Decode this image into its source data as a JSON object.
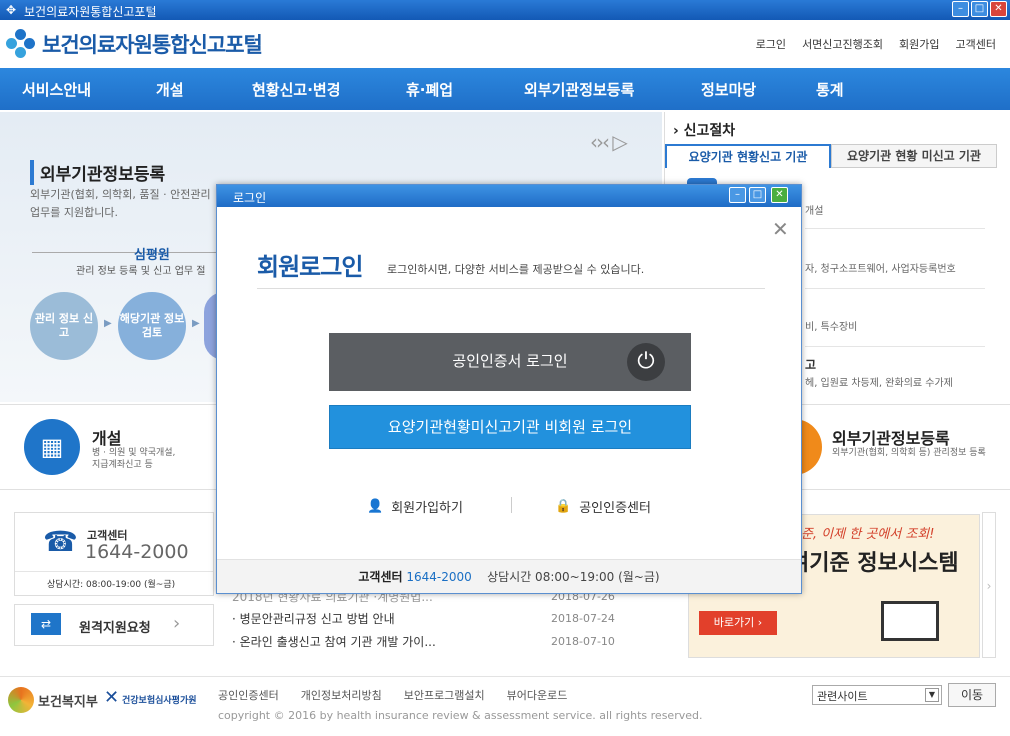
{
  "window": {
    "title": "보건의료자원통합신고포털"
  },
  "header": {
    "logo_text": "보건의료자원통합신고포털",
    "util_links": [
      "로그인",
      "서면신고진행조회",
      "회원가입",
      "고객센터"
    ]
  },
  "gnb": {
    "items": [
      "서비스안내",
      "개설",
      "현황신고·변경",
      "휴·폐업",
      "외부기관정보등록",
      "정보마당",
      "통계"
    ]
  },
  "visual": {
    "title": "외부기관정보등록",
    "desc": "외부기관(협회, 의학회, 품질 · 안전관리",
    "desc2": "업무를 지원합니다.",
    "sim_title": "심평원",
    "sim_desc": "관리 정보 등록 및 신고 업무 절",
    "steps": [
      "관리 정보 신고",
      "해당기관 정보검토"
    ]
  },
  "right_panel": {
    "heading": "신고절차",
    "tabs": [
      "요양기관 현황신고 기관",
      "요양기관 현황 미신고 기관"
    ],
    "items": [
      "개설",
      "자, 청구소프트웨어, 사업자등록번호",
      "비, 특수장비",
      "고",
      "헤, 입원료 차등제, 완화의료 수가제"
    ]
  },
  "quick": {
    "open_title": "개설",
    "open_desc1": "병 · 의원 및 약국개설,",
    "open_desc2": "지급계좌신고 등",
    "ext_title": "외부기관정보등록",
    "ext_desc": "외부기관(협회, 의학회 등) 관리정보 등록"
  },
  "callcenter": {
    "label": "고객센터",
    "number": "1644-2000",
    "hours": "상담시간: 08:00-19:00 (월~금)"
  },
  "remote": {
    "label": "원격지원요청"
  },
  "news": [
    {
      "title": "2018년 현황자료 의료기관 ·계명원법...",
      "date": "2018-07-26"
    },
    {
      "title": "병문안관리규정 신고 방법 안내",
      "date": "2018-07-24"
    },
    {
      "title": "온라인 출생신고 참여 기관 개발 가이...",
      "date": "2018-07-10"
    }
  ],
  "banner": {
    "text1": "기준, 이제 한 곳에서 조회!",
    "text2": "여기준 정보시스템",
    "button": "바로가기 ›"
  },
  "footer": {
    "links": [
      "공인인증센터",
      "개인정보처리방침",
      "보안프로그램설치",
      "뷰어다운로드"
    ],
    "copyright": "copyright © 2016 by health insurance review & assessment service. all rights reserved.",
    "org1": "보건복지부",
    "org2": "건강보험심사평가원",
    "related_site": "관련사이트",
    "go": "이동"
  },
  "modal": {
    "title_bar": "로그인",
    "heading": "회원로그인",
    "desc": "로그인하시면, 다양한 서비스를 제공받으실 수 있습니다.",
    "cert_login": "공인인증서 로그인",
    "guest_login": "요양기관현황미신고기관 비회원 로그인",
    "join": "회원가입하기",
    "cert_center": "공인인증센터",
    "foot_label": "고객센터",
    "foot_number": "1644-2000",
    "foot_hours": "상담시간 08:00~19:00 (월~금)"
  }
}
